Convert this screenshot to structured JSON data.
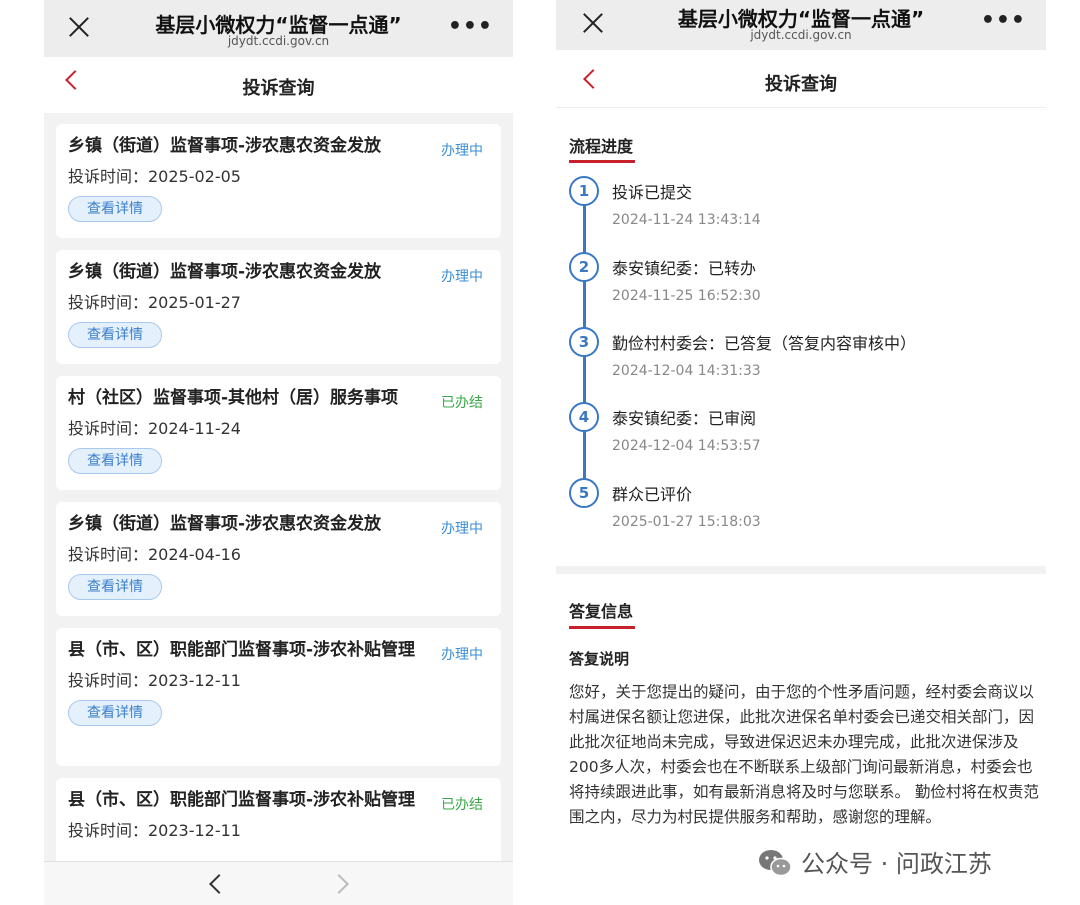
{
  "left": {
    "topbar": {
      "title": "基层小微权力“监督一点通”",
      "url": "jdydt.ccdi.gov.cn",
      "more": "•••"
    },
    "nav": {
      "title": "投诉查询"
    },
    "complaints": [
      {
        "title": "乡镇（街道）监督事项-涉农惠农资金发放",
        "status": "办理中",
        "time": "投诉时间：2025-02-05",
        "button": "查看详情"
      },
      {
        "title": "乡镇（街道）监督事项-涉农惠农资金发放",
        "status": "办理中",
        "time": "投诉时间：2025-01-27",
        "button": "查看详情"
      },
      {
        "title": "村（社区）监督事项-其他村（居）服务事项",
        "status": "已办结",
        "time": "投诉时间：2024-11-24",
        "button": "查看详情"
      },
      {
        "title": "乡镇（街道）监督事项-涉农惠农资金发放",
        "status": "办理中",
        "time": "投诉时间：2024-04-16",
        "button": "查看详情"
      },
      {
        "title": "县（市、区）职能部门监督事项-涉农补贴管理",
        "status": "办理中",
        "time": "投诉时间：2023-12-11",
        "button": "查看详情"
      },
      {
        "title": "县（市、区）职能部门监督事项-涉农补贴管理",
        "status": "已办结",
        "time": "投诉时间：2023-12-11",
        "button": ""
      }
    ]
  },
  "right": {
    "topbar": {
      "title": "基层小微权力“监督一点通”",
      "url": "jdydt.ccdi.gov.cn",
      "more": "•••"
    },
    "nav": {
      "title": "投诉查询"
    },
    "progress": {
      "title": "流程进度",
      "steps": [
        {
          "num": "1",
          "label": "投诉已提交",
          "time": "2024-11-24 13:43:14"
        },
        {
          "num": "2",
          "label": "泰安镇纪委：已转办",
          "time": "2024-11-25 16:52:30"
        },
        {
          "num": "3",
          "label": "勤俭村村委会：已答复（答复内容审核中）",
          "time": "2024-12-04 14:31:33"
        },
        {
          "num": "4",
          "label": "泰安镇纪委：已审阅",
          "time": "2024-12-04 14:53:57"
        },
        {
          "num": "5",
          "label": "群众已评价",
          "time": "2025-01-27 15:18:03"
        }
      ]
    },
    "reply": {
      "title": "答复信息",
      "subtitle": "答复说明",
      "text": "您好，关于您提出的疑问，由于您的个性矛盾问题，经村委会商议以村属进保名额让您进保，此批次进保名单村委会已递交相关部门，因此批次征地尚未完成，导致进保迟迟未办理完成，此批次进保涉及200多人次，村委会也在不断联系上级部门询问最新消息，村委会也将持续跟进此事，如有最新消息将及时与您联系。 勤俭村将在权责范围之内，尽力为村民提供服务和帮助，感谢您的理解。"
    }
  },
  "watermark": {
    "text": "公众号 · 问政江苏"
  },
  "colors": {
    "accent_red": "#c8202a",
    "processing_blue": "#3b8ed8",
    "done_green": "#3aa84a",
    "timeline_blue": "#3b78c4"
  }
}
